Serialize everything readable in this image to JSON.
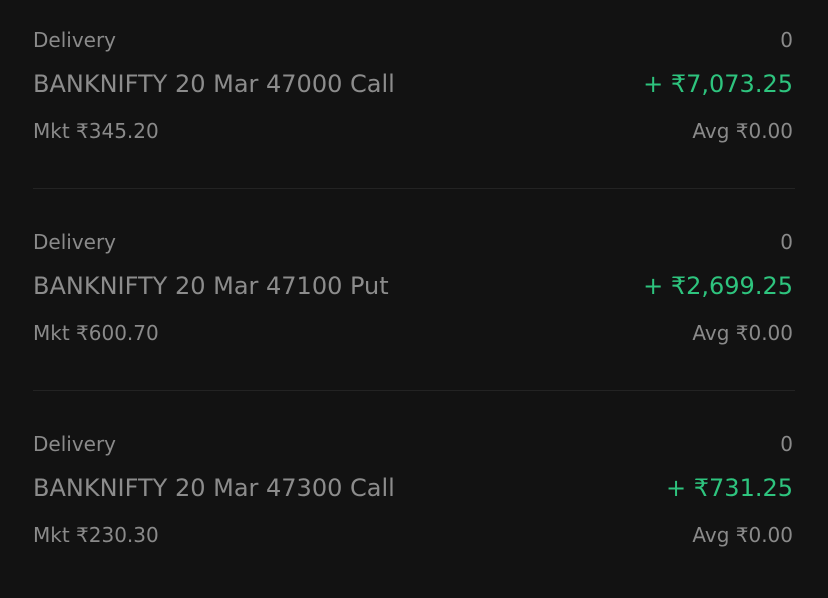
{
  "positions": [
    {
      "product": "Delivery",
      "qty": "0",
      "instrument": "BANKNIFTY 20 Mar 47000 Call",
      "pnl": "+ ₹7,073.25",
      "mkt": "Mkt ₹345.20",
      "avg": "Avg ₹0.00"
    },
    {
      "product": "Delivery",
      "qty": "0",
      "instrument": "BANKNIFTY 20 Mar 47100 Put",
      "pnl": "+ ₹2,699.25",
      "mkt": "Mkt ₹600.70",
      "avg": "Avg ₹0.00"
    },
    {
      "product": "Delivery",
      "qty": "0",
      "instrument": "BANKNIFTY 20 Mar 47300 Call",
      "pnl": "+ ₹731.25",
      "mkt": "Mkt ₹230.30",
      "avg": "Avg ₹0.00"
    }
  ],
  "colors": {
    "background": "#121212",
    "profit": "#2ec47e",
    "muted_text": "#8a8a8a"
  }
}
